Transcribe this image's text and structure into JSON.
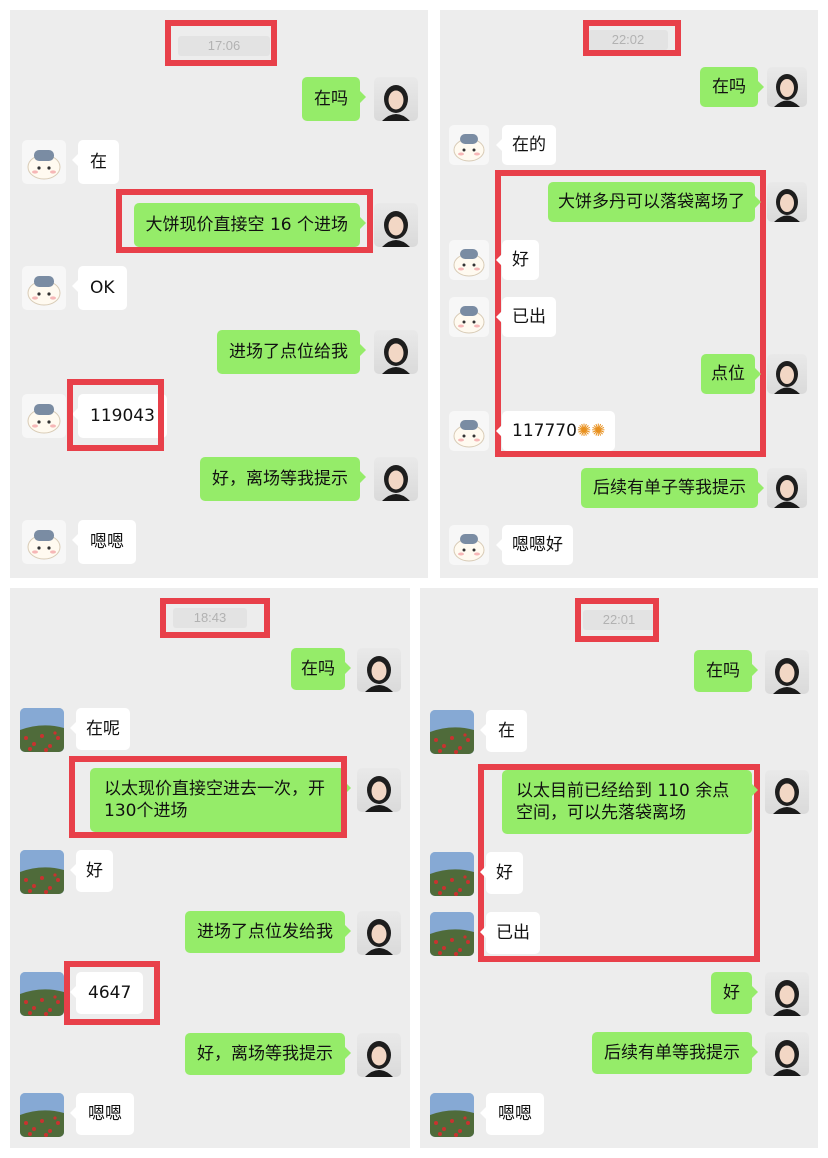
{
  "panels": [
    {
      "timestamp": "17:06",
      "messages": [
        {
          "from": "me",
          "text": "在吗"
        },
        {
          "from": "them",
          "text": "在"
        },
        {
          "from": "me",
          "text": "大饼现价直接空 16 个进场"
        },
        {
          "from": "them",
          "text": "OK"
        },
        {
          "from": "me",
          "text": "进场了点位给我"
        },
        {
          "from": "them",
          "text": "119043"
        },
        {
          "from": "me",
          "text": "好，离场等我提示"
        },
        {
          "from": "them",
          "text": "嗯嗯"
        }
      ]
    },
    {
      "timestamp": "22:02",
      "messages": [
        {
          "from": "me",
          "text": "在吗"
        },
        {
          "from": "them",
          "text": "在的"
        },
        {
          "from": "me",
          "text": "大饼多丹可以落袋离场了"
        },
        {
          "from": "them",
          "text": "好"
        },
        {
          "from": "them",
          "text": "已出"
        },
        {
          "from": "me",
          "text": "点位"
        },
        {
          "from": "them",
          "text": "117770"
        },
        {
          "from": "me",
          "text": "后续有单子等我提示"
        },
        {
          "from": "them",
          "text": "嗯嗯好"
        }
      ]
    },
    {
      "timestamp": "18:43",
      "messages": [
        {
          "from": "me",
          "text": "在吗"
        },
        {
          "from": "them",
          "text": "在呢"
        },
        {
          "from": "me",
          "text": "以太现价直接空进去一次，开130个进场"
        },
        {
          "from": "them",
          "text": "好"
        },
        {
          "from": "me",
          "text": "进场了点位发给我"
        },
        {
          "from": "them",
          "text": "4647"
        },
        {
          "from": "me",
          "text": "好，离场等我提示"
        },
        {
          "from": "them",
          "text": "嗯嗯"
        }
      ]
    },
    {
      "timestamp": "22:01",
      "messages": [
        {
          "from": "me",
          "text": "在吗"
        },
        {
          "from": "them",
          "text": "在"
        },
        {
          "from": "me",
          "text": "以太目前已经给到 110 余点空间，可以先落袋离场"
        },
        {
          "from": "them",
          "text": "好"
        },
        {
          "from": "them",
          "text": "已出"
        },
        {
          "from": "me",
          "text": "好"
        },
        {
          "from": "me",
          "text": "后续有单等我提示"
        },
        {
          "from": "them",
          "text": "嗯嗯"
        }
      ]
    }
  ],
  "colors": {
    "panel_bg": "#ededed",
    "my_bubble": "#95ec69",
    "their_bubble": "#ffffff",
    "highlight": "#e8404a"
  },
  "icons": {
    "my_avatar": "portrait-avatar",
    "contact_avatar_top": "sheep-avatar",
    "contact_avatar_bottom": "flower-field-avatar",
    "emoji": "sun-emoji"
  }
}
